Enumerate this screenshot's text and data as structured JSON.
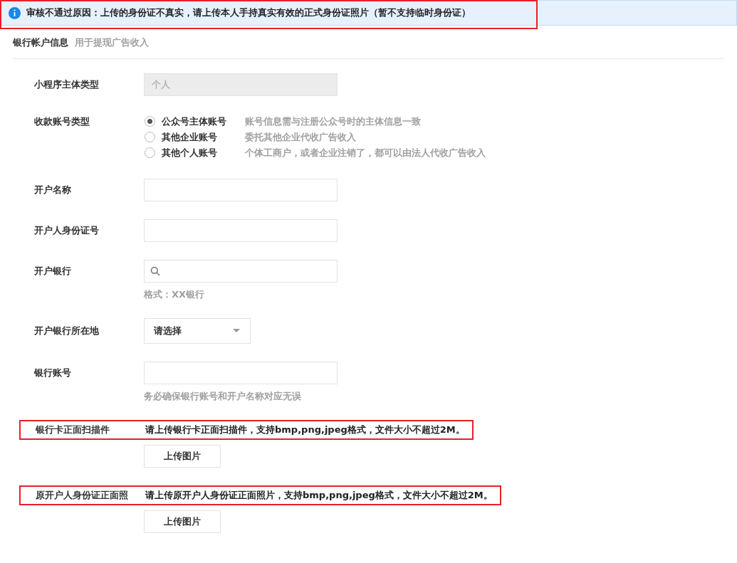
{
  "alert": {
    "text": "审核不通过原因：上传的身份证不真实，请上传本人手持真实有效的正式身份证照片（暂不支持临时身份证）",
    "highlighted": true
  },
  "section": {
    "title": "银行帐户信息",
    "subtitle": "用于提现广告收入"
  },
  "fields": [
    {
      "kind": "input",
      "label": "小程序主体类型",
      "value": "个人",
      "disabled": true
    },
    {
      "kind": "radio",
      "label": "收款账号类型",
      "options": [
        {
          "label": "公众号主体账号",
          "note": "账号信息需与注册公众号时的主体信息一致",
          "selected": true
        },
        {
          "label": "其他企业账号",
          "note": "委托其他企业代收广告收入",
          "selected": false
        },
        {
          "label": "其他个人账号",
          "note": "个体工商户，或者企业注销了，都可以由法人代收广告收入",
          "selected": false
        }
      ]
    },
    {
      "kind": "input",
      "label": "开户名称",
      "disabled": false
    },
    {
      "kind": "input",
      "label": "开户人身份证号",
      "disabled": false
    },
    {
      "kind": "search",
      "label": "开户银行",
      "hint": "格式：XX银行"
    },
    {
      "kind": "select",
      "label": "开户银行所在地",
      "value": "请选择"
    },
    {
      "kind": "input",
      "label": "银行账号",
      "disabled": false,
      "hint": "务必确保银行账号和开户名称对应无误"
    },
    {
      "kind": "upload",
      "label": "银行卡正面扫描件",
      "note": "请上传银行卡正面扫描件，支持bmp,png,jpeg格式，文件大小不超过2M。",
      "button": "上传图片",
      "highlighted": true
    },
    {
      "kind": "upload",
      "label": "原开户人身份证正面照",
      "note": "请上传原开户人身份证正面照片，支持bmp,png,jpeg格式，文件大小不超过2M。",
      "button": "上传图片",
      "highlighted": true
    }
  ]
}
